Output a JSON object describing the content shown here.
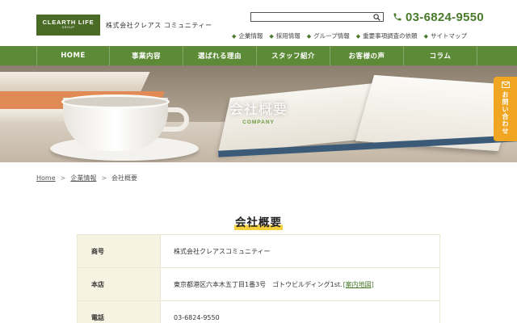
{
  "header": {
    "logo_main": "CLEARTH LIFE",
    "logo_sub": "GROUP",
    "company_name": "株式会社クレアス コミュニティー",
    "search": {
      "placeholder": "",
      "value": ""
    },
    "phone": "03-6824-9550",
    "sub_nav": [
      {
        "label": "企業情報"
      },
      {
        "label": "採用情報"
      },
      {
        "label": "グループ情報"
      },
      {
        "label": "重要事項調査の依頼"
      },
      {
        "label": "サイトマップ"
      }
    ]
  },
  "main_nav": [
    {
      "label": "HOME"
    },
    {
      "label": "事業内容"
    },
    {
      "label": "選ばれる理由"
    },
    {
      "label": "スタッフ紹介"
    },
    {
      "label": "お客様の声"
    },
    {
      "label": "コラム"
    }
  ],
  "hero": {
    "title": "会社概要",
    "subtitle": "COMPANY"
  },
  "contact_tab": {
    "label": "お問い合わせ"
  },
  "breadcrumb": [
    {
      "label": "Home"
    },
    {
      "label": "企業情報"
    },
    {
      "label": "会社概要"
    }
  ],
  "breadcrumb_sep": ">",
  "section_title": "会社概要",
  "table": {
    "rows": [
      {
        "label": "商号",
        "value": "株式会社クレアスコミュニティー"
      },
      {
        "label": "本店",
        "value": "東京都港区六本木五丁目1番3号　ゴトウビルディング1st. ",
        "link_text": "[案内地図]"
      },
      {
        "label": "電話",
        "value": "03-6824-9550"
      }
    ]
  },
  "colors": {
    "brand_green": "#5c8a36",
    "logo_green": "#4a6b26",
    "accent_orange": "#f0a623",
    "highlight_yellow": "#f5d03f",
    "table_header_bg": "#f7f3e3"
  }
}
